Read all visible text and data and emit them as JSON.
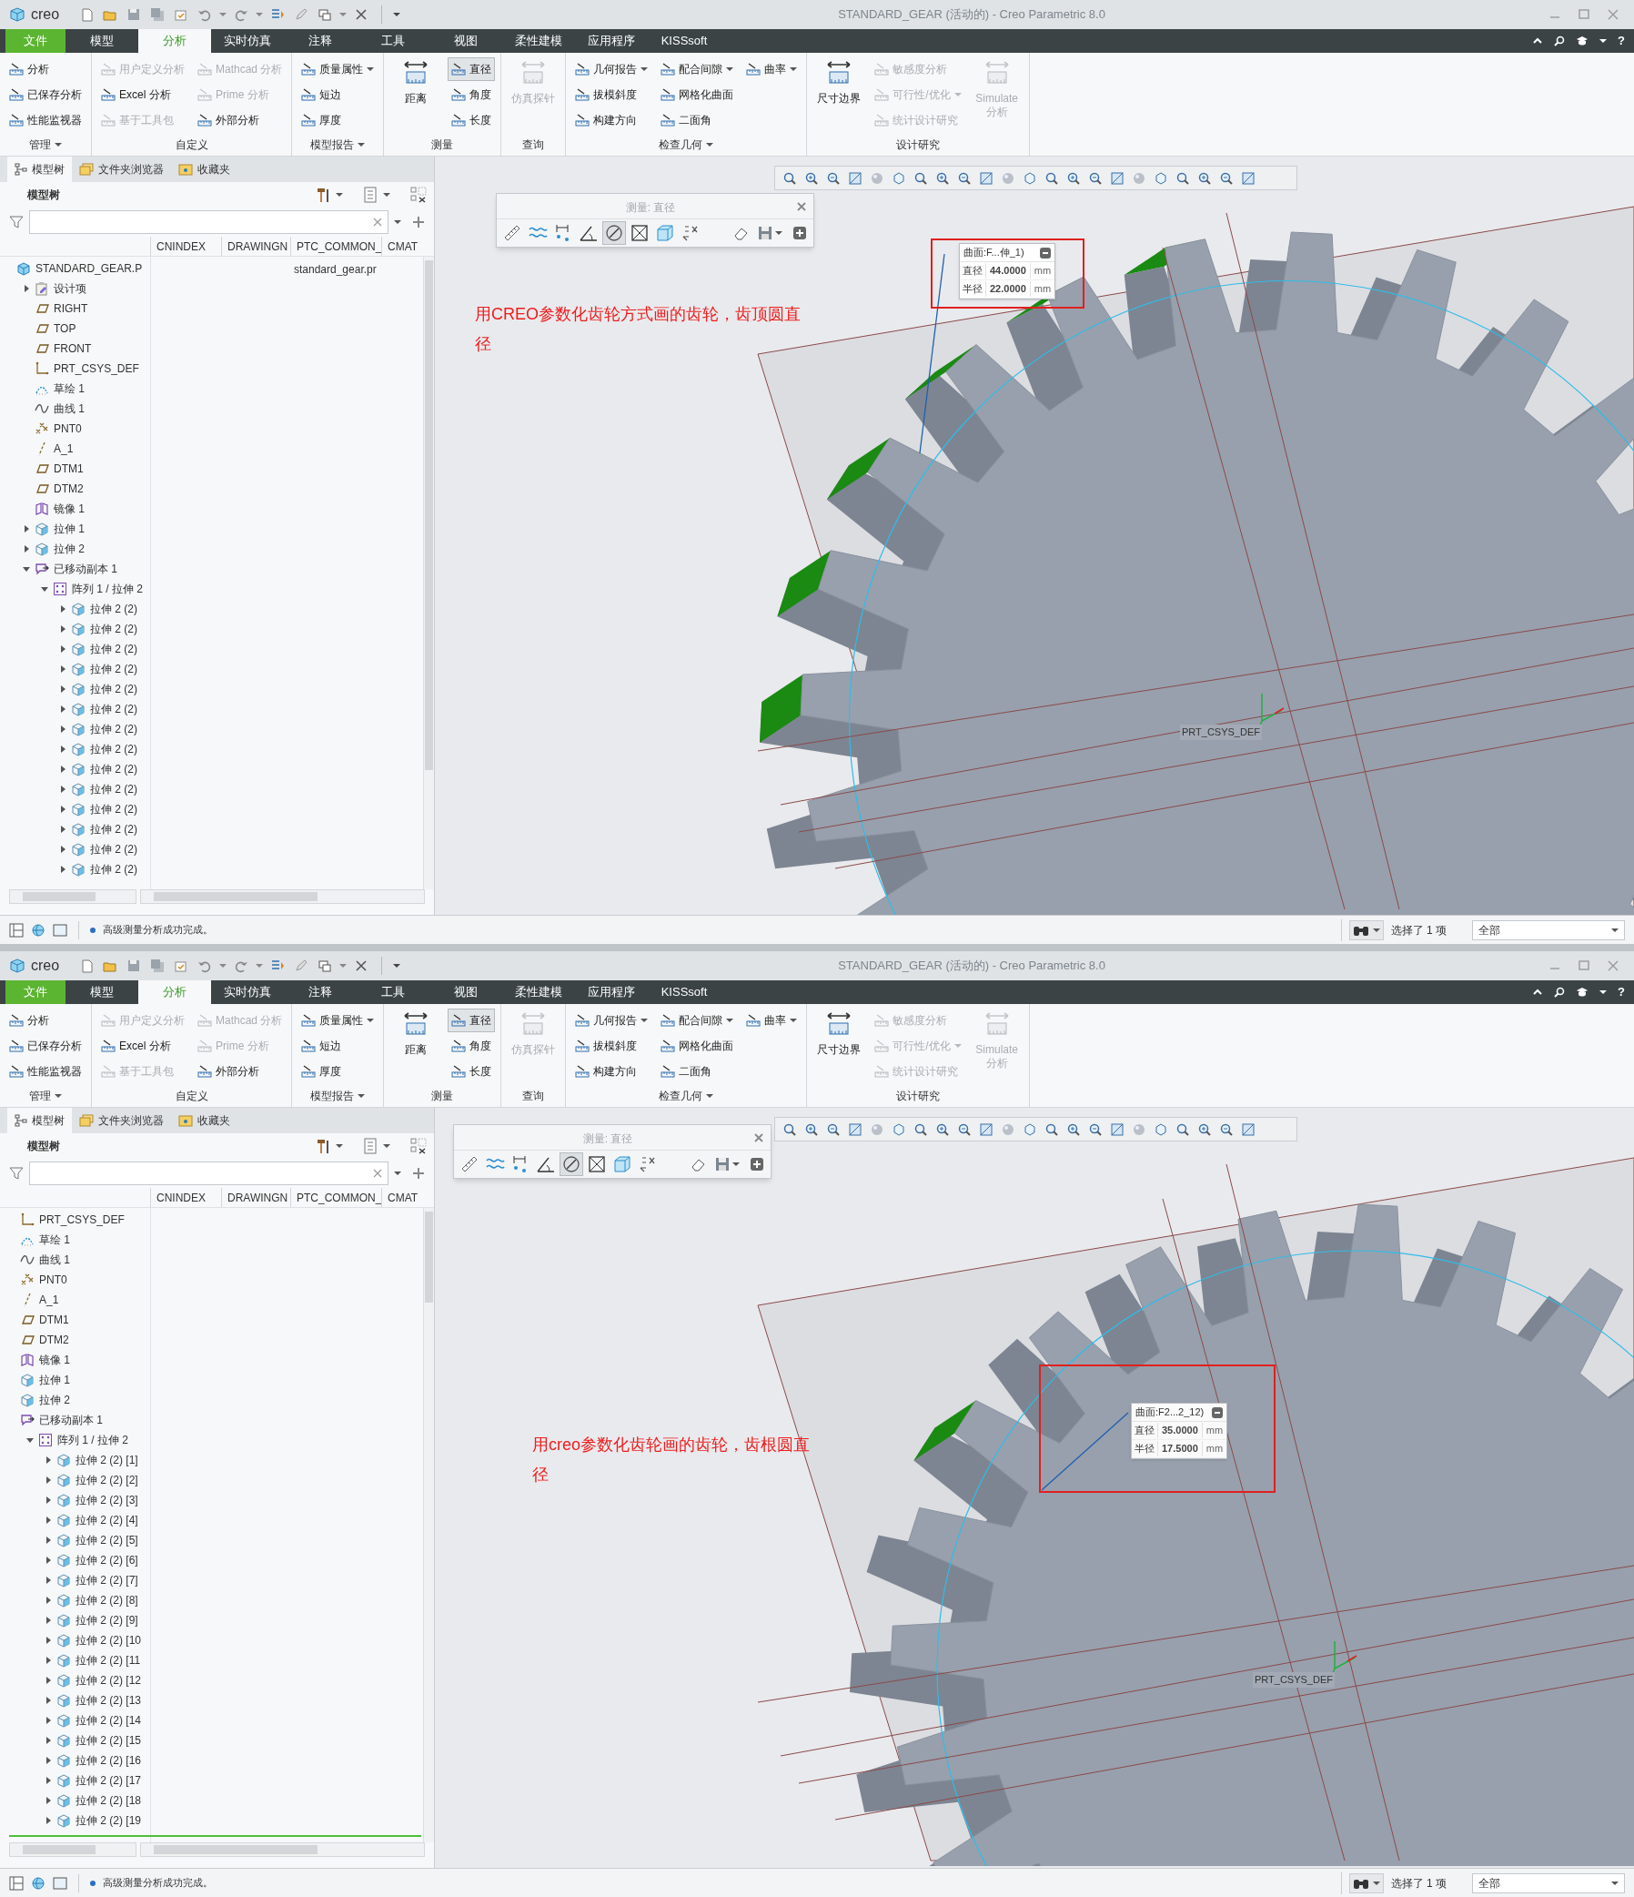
{
  "windows": [
    {
      "title_bar": {
        "logo": "creo",
        "title": "STANDARD_GEAR (活动的) - Creo Parametric 8.0"
      },
      "menu_tabs": [
        {
          "label": "文件",
          "kind": "file",
          "selected": false
        },
        {
          "label": "模型",
          "kind": "tab",
          "selected": false
        },
        {
          "label": "分析",
          "kind": "tab",
          "selected": true
        },
        {
          "label": "实时仿真",
          "kind": "tab",
          "selected": false
        },
        {
          "label": "注释",
          "kind": "tab",
          "selected": false
        },
        {
          "label": "工具",
          "kind": "tab",
          "selected": false
        },
        {
          "label": "视图",
          "kind": "tab",
          "selected": false
        },
        {
          "label": "柔性建模",
          "kind": "tab",
          "selected": false
        },
        {
          "label": "应用程序",
          "kind": "tab",
          "selected": false
        },
        {
          "label": "KISSsoft",
          "kind": "tab",
          "selected": false
        }
      ],
      "help": "?",
      "ribbon": [
        {
          "label": "管理",
          "dropdown": true,
          "columns": [
            [
              {
                "label": "分析",
                "kind": "small",
                "disabled": false
              },
              {
                "label": "已保存分析",
                "kind": "small",
                "disabled": false
              },
              {
                "label": "性能监视器",
                "kind": "small",
                "disabled": false
              }
            ]
          ]
        },
        {
          "label": "自定义",
          "dropdown": false,
          "columns": [
            [
              {
                "label": "用户定义分析",
                "kind": "small",
                "disabled": true
              },
              {
                "label": "Excel 分析",
                "kind": "small",
                "disabled": false
              },
              {
                "label": "基于工具包",
                "kind": "small",
                "disabled": true
              }
            ],
            [
              {
                "label": "Mathcad 分析",
                "kind": "small",
                "disabled": true
              },
              {
                "label": "Prime 分析",
                "kind": "small",
                "disabled": true
              },
              {
                "label": "外部分析",
                "kind": "small",
                "disabled": false
              }
            ]
          ]
        },
        {
          "label": "模型报告",
          "dropdown": true,
          "columns": [
            [
              {
                "label": "质量属性",
                "kind": "small",
                "disabled": false,
                "dropdown": true
              },
              {
                "label": "短边",
                "kind": "small",
                "disabled": false
              },
              {
                "label": "厚度",
                "kind": "small",
                "disabled": false
              }
            ]
          ]
        },
        {
          "label": "测量",
          "dropdown": false,
          "columns": [
            [
              {
                "label": "距离",
                "kind": "large",
                "disabled": false,
                "selected": false
              }
            ],
            [
              {
                "label": "直径",
                "kind": "small",
                "disabled": false,
                "selected": true
              },
              {
                "label": "角度",
                "kind": "small",
                "disabled": false,
                "selected": false
              },
              {
                "label": "长度",
                "kind": "small",
                "disabled": false,
                "selected": false
              }
            ]
          ]
        },
        {
          "label": "查询",
          "dropdown": false,
          "columns": [
            [
              {
                "label": "仿真探针",
                "kind": "large",
                "disabled": true
              }
            ]
          ]
        },
        {
          "label": "检查几何",
          "dropdown": true,
          "columns": [
            [
              {
                "label": "几何报告",
                "kind": "small",
                "disabled": false,
                "dropdown": true
              },
              {
                "label": "拔模斜度",
                "kind": "small",
                "disabled": false
              },
              {
                "label": "构建方向",
                "kind": "small",
                "disabled": false
              }
            ],
            [
              {
                "label": "配合间隙",
                "kind": "small",
                "disabled": false,
                "dropdown": true
              },
              {
                "label": "网格化曲面",
                "kind": "small",
                "disabled": false
              },
              {
                "label": "二面角",
                "kind": "small",
                "disabled": false
              }
            ],
            [
              {
                "label": "曲率",
                "kind": "small",
                "disabled": false,
                "dropdown": true
              }
            ]
          ]
        },
        {
          "label": "设计研究",
          "dropdown": false,
          "columns": [
            [
              {
                "label": "尺寸边界",
                "kind": "large",
                "disabled": false
              }
            ],
            [
              {
                "label": "敏感度分析",
                "kind": "small",
                "disabled": true
              },
              {
                "label": "可行性/优化",
                "kind": "small",
                "disabled": true,
                "dropdown": true
              },
              {
                "label": "统计设计研究",
                "kind": "small",
                "disabled": true
              }
            ],
            [
              {
                "label": "Simulate 分析",
                "kind": "large",
                "disabled": true
              }
            ]
          ]
        }
      ],
      "panel_tabs": [
        {
          "label": "模型树",
          "selected": true
        },
        {
          "label": "文件夹浏览器",
          "selected": false
        },
        {
          "label": "收藏夹",
          "selected": false
        }
      ],
      "tree_title": "模型树",
      "tree_columns": [
        "CNINDEX",
        "DRAWINGN",
        "PTC_COMMON_",
        "CMAT"
      ],
      "tree": [
        {
          "label": "STANDARD_GEAR.P",
          "kind": "part",
          "ptc_common": "standard_gear.pr",
          "children": [
            {
              "label": "设计项",
              "kind": "design_items",
              "expanded": false
            },
            {
              "label": "RIGHT",
              "kind": "plane"
            },
            {
              "label": "TOP",
              "kind": "plane"
            },
            {
              "label": "FRONT",
              "kind": "plane"
            },
            {
              "label": "PRT_CSYS_DEF",
              "kind": "csys"
            },
            {
              "label": "草绘 1",
              "kind": "sketch"
            },
            {
              "label": "曲线 1",
              "kind": "curve"
            },
            {
              "label": "PNT0",
              "kind": "point"
            },
            {
              "label": "A_1",
              "kind": "axis"
            },
            {
              "label": "DTM1",
              "kind": "plane"
            },
            {
              "label": "DTM2",
              "kind": "plane"
            },
            {
              "label": "镜像 1",
              "kind": "mirror"
            },
            {
              "label": "拉伸 1",
              "kind": "extrude",
              "expanded": false
            },
            {
              "label": "拉伸 2",
              "kind": "extrude",
              "expanded": false
            },
            {
              "label": "已移动副本 1",
              "kind": "copy",
              "expanded": true,
              "children": [
                {
                  "label": "阵列 1 / 拉伸 2",
                  "kind": "pattern",
                  "expanded": true,
                  "children": [
                    {
                      "label": "拉伸 2 (2)",
                      "kind": "extrude",
                      "expanded": false
                    },
                    {
                      "label": "拉伸 2 (2)",
                      "kind": "extrude",
                      "expanded": false
                    },
                    {
                      "label": "拉伸 2 (2)",
                      "kind": "extrude",
                      "expanded": false
                    },
                    {
                      "label": "拉伸 2 (2)",
                      "kind": "extrude",
                      "expanded": false
                    },
                    {
                      "label": "拉伸 2 (2)",
                      "kind": "extrude",
                      "expanded": false
                    },
                    {
                      "label": "拉伸 2 (2)",
                      "kind": "extrude",
                      "expanded": false
                    },
                    {
                      "label": "拉伸 2 (2)",
                      "kind": "extrude",
                      "expanded": false
                    },
                    {
                      "label": "拉伸 2 (2)",
                      "kind": "extrude",
                      "expanded": false
                    },
                    {
                      "label": "拉伸 2 (2)",
                      "kind": "extrude",
                      "expanded": false
                    },
                    {
                      "label": "拉伸 2 (2)",
                      "kind": "extrude",
                      "expanded": false
                    },
                    {
                      "label": "拉伸 2 (2)",
                      "kind": "extrude",
                      "expanded": false
                    },
                    {
                      "label": "拉伸 2 (2)",
                      "kind": "extrude",
                      "expanded": false
                    },
                    {
                      "label": "拉伸 2 (2)",
                      "kind": "extrude",
                      "expanded": false
                    },
                    {
                      "label": "拉伸 2 (2)",
                      "kind": "extrude",
                      "expanded": false
                    }
                  ]
                }
              ]
            }
          ]
        }
      ],
      "measure_popup": {
        "title": "测量: 直径",
        "tools": [
          {
            "selected": false
          },
          {
            "selected": false
          },
          {
            "selected": false
          },
          {
            "selected": false
          },
          {
            "selected": true
          },
          {
            "selected": false
          },
          {
            "selected": false
          },
          {
            "selected": false
          }
        ]
      },
      "measure_result": {
        "title": "曲面:F...伸_1)",
        "rows": [
          {
            "label": "直径",
            "value": "44.0000",
            "unit": "mm"
          },
          {
            "label": "半径",
            "value": "22.0000",
            "unit": "mm"
          }
        ]
      },
      "annotation": "用CREO参数化齿轮方式画的齿轮，齿顶圆直径",
      "csys_label": "PRT_CSYS_DEF",
      "status_bar": {
        "message": "高级测量分析成功完成。",
        "selection": "选择了 1 项",
        "filter": "全部"
      }
    },
    {
      "title_bar": {
        "logo": "creo",
        "title": "STANDARD_GEAR (活动的) - Creo Parametric 8.0"
      },
      "menu_tabs": [
        {
          "label": "文件",
          "kind": "file",
          "selected": false
        },
        {
          "label": "模型",
          "kind": "tab",
          "selected": false
        },
        {
          "label": "分析",
          "kind": "tab",
          "selected": true
        },
        {
          "label": "实时仿真",
          "kind": "tab",
          "selected": false
        },
        {
          "label": "注释",
          "kind": "tab",
          "selected": false
        },
        {
          "label": "工具",
          "kind": "tab",
          "selected": false
        },
        {
          "label": "视图",
          "kind": "tab",
          "selected": false
        },
        {
          "label": "柔性建模",
          "kind": "tab",
          "selected": false
        },
        {
          "label": "应用程序",
          "kind": "tab",
          "selected": false
        },
        {
          "label": "KISSsoft",
          "kind": "tab",
          "selected": false
        }
      ],
      "help": "?",
      "ribbon": [
        {
          "label": "管理",
          "dropdown": true,
          "columns": [
            [
              {
                "label": "分析",
                "kind": "small",
                "disabled": false
              },
              {
                "label": "已保存分析",
                "kind": "small",
                "disabled": false
              },
              {
                "label": "性能监视器",
                "kind": "small",
                "disabled": false
              }
            ]
          ]
        },
        {
          "label": "自定义",
          "dropdown": false,
          "columns": [
            [
              {
                "label": "用户定义分析",
                "kind": "small",
                "disabled": true
              },
              {
                "label": "Excel 分析",
                "kind": "small",
                "disabled": false
              },
              {
                "label": "基于工具包",
                "kind": "small",
                "disabled": true
              }
            ],
            [
              {
                "label": "Mathcad 分析",
                "kind": "small",
                "disabled": true
              },
              {
                "label": "Prime 分析",
                "kind": "small",
                "disabled": true
              },
              {
                "label": "外部分析",
                "kind": "small",
                "disabled": false
              }
            ]
          ]
        },
        {
          "label": "模型报告",
          "dropdown": true,
          "columns": [
            [
              {
                "label": "质量属性",
                "kind": "small",
                "disabled": false,
                "dropdown": true
              },
              {
                "label": "短边",
                "kind": "small",
                "disabled": false
              },
              {
                "label": "厚度",
                "kind": "small",
                "disabled": false
              }
            ]
          ]
        },
        {
          "label": "测量",
          "dropdown": false,
          "columns": [
            [
              {
                "label": "距离",
                "kind": "large",
                "disabled": false,
                "selected": false
              }
            ],
            [
              {
                "label": "直径",
                "kind": "small",
                "disabled": false,
                "selected": true
              },
              {
                "label": "角度",
                "kind": "small",
                "disabled": false,
                "selected": false
              },
              {
                "label": "长度",
                "kind": "small",
                "disabled": false,
                "selected": false
              }
            ]
          ]
        },
        {
          "label": "查询",
          "dropdown": false,
          "columns": [
            [
              {
                "label": "仿真探针",
                "kind": "large",
                "disabled": true
              }
            ]
          ]
        },
        {
          "label": "检查几何",
          "dropdown": true,
          "columns": [
            [
              {
                "label": "几何报告",
                "kind": "small",
                "disabled": false,
                "dropdown": true
              },
              {
                "label": "拔模斜度",
                "kind": "small",
                "disabled": false
              },
              {
                "label": "构建方向",
                "kind": "small",
                "disabled": false
              }
            ],
            [
              {
                "label": "配合间隙",
                "kind": "small",
                "disabled": false,
                "dropdown": true
              },
              {
                "label": "网格化曲面",
                "kind": "small",
                "disabled": false
              },
              {
                "label": "二面角",
                "kind": "small",
                "disabled": false
              }
            ],
            [
              {
                "label": "曲率",
                "kind": "small",
                "disabled": false,
                "dropdown": true
              }
            ]
          ]
        },
        {
          "label": "设计研究",
          "dropdown": false,
          "columns": [
            [
              {
                "label": "尺寸边界",
                "kind": "large",
                "disabled": false
              }
            ],
            [
              {
                "label": "敏感度分析",
                "kind": "small",
                "disabled": true
              },
              {
                "label": "可行性/优化",
                "kind": "small",
                "disabled": true,
                "dropdown": true
              },
              {
                "label": "统计设计研究",
                "kind": "small",
                "disabled": true
              }
            ],
            [
              {
                "label": "Simulate 分析",
                "kind": "large",
                "disabled": true
              }
            ]
          ]
        }
      ],
      "panel_tabs": [
        {
          "label": "模型树",
          "selected": true
        },
        {
          "label": "文件夹浏览器",
          "selected": false
        },
        {
          "label": "收藏夹",
          "selected": false
        }
      ],
      "tree_title": "模型树",
      "tree_columns": [
        "CNINDEX",
        "DRAWINGN",
        "PTC_COMMON_",
        "CMAT"
      ],
      "tree": [
        {
          "label": "PRT_CSYS_DEF",
          "kind": "csys"
        },
        {
          "label": "草绘 1",
          "kind": "sketch"
        },
        {
          "label": "曲线 1",
          "kind": "curve"
        },
        {
          "label": "PNT0",
          "kind": "point"
        },
        {
          "label": "A_1",
          "kind": "axis"
        },
        {
          "label": "DTM1",
          "kind": "plane"
        },
        {
          "label": "DTM2",
          "kind": "plane"
        },
        {
          "label": "镜像 1",
          "kind": "mirror"
        },
        {
          "label": "拉伸 1",
          "kind": "extrude"
        },
        {
          "label": "拉伸 2",
          "kind": "extrude"
        },
        {
          "label": "已移动副本 1",
          "kind": "copy",
          "children": [
            {
              "label": "阵列 1 / 拉伸 2",
              "kind": "pattern",
              "expanded": true,
              "children": [
                {
                  "label": "拉伸 2 (2) [1]",
                  "kind": "extrude",
                  "expanded": false
                },
                {
                  "label": "拉伸 2 (2) [2]",
                  "kind": "extrude",
                  "expanded": false
                },
                {
                  "label": "拉伸 2 (2) [3]",
                  "kind": "extrude",
                  "expanded": false
                },
                {
                  "label": "拉伸 2 (2) [4]",
                  "kind": "extrude",
                  "expanded": false
                },
                {
                  "label": "拉伸 2 (2) [5]",
                  "kind": "extrude",
                  "expanded": false
                },
                {
                  "label": "拉伸 2 (2) [6]",
                  "kind": "extrude",
                  "expanded": false
                },
                {
                  "label": "拉伸 2 (2) [7]",
                  "kind": "extrude",
                  "expanded": false
                },
                {
                  "label": "拉伸 2 (2) [8]",
                  "kind": "extrude",
                  "expanded": false
                },
                {
                  "label": "拉伸 2 (2) [9]",
                  "kind": "extrude",
                  "expanded": false
                },
                {
                  "label": "拉伸 2 (2) [10",
                  "kind": "extrude",
                  "expanded": false
                },
                {
                  "label": "拉伸 2 (2) [11",
                  "kind": "extrude",
                  "expanded": false
                },
                {
                  "label": "拉伸 2 (2) [12",
                  "kind": "extrude",
                  "expanded": false
                },
                {
                  "label": "拉伸 2 (2) [13",
                  "kind": "extrude",
                  "expanded": false
                },
                {
                  "label": "拉伸 2 (2) [14",
                  "kind": "extrude",
                  "expanded": false
                },
                {
                  "label": "拉伸 2 (2) [15",
                  "kind": "extrude",
                  "expanded": false
                },
                {
                  "label": "拉伸 2 (2) [16",
                  "kind": "extrude",
                  "expanded": false
                },
                {
                  "label": "拉伸 2 (2) [17",
                  "kind": "extrude",
                  "expanded": false
                },
                {
                  "label": "拉伸 2 (2) [18",
                  "kind": "extrude",
                  "expanded": false
                },
                {
                  "label": "拉伸 2 (2) [19",
                  "kind": "extrude",
                  "expanded": false
                }
              ]
            }
          ]
        }
      ],
      "measure_popup": {
        "title": "测量: 直径",
        "tools": [
          {
            "selected": false
          },
          {
            "selected": false
          },
          {
            "selected": false
          },
          {
            "selected": false
          },
          {
            "selected": true
          },
          {
            "selected": false
          },
          {
            "selected": false
          },
          {
            "selected": false
          }
        ]
      },
      "measure_result": {
        "title": "曲面:F2...2_12)",
        "rows": [
          {
            "label": "直径",
            "value": "35.0000",
            "unit": "mm"
          },
          {
            "label": "半径",
            "value": "17.5000",
            "unit": "mm"
          }
        ]
      },
      "annotation": "用creo参数化齿轮画的齿轮，齿根圆直径",
      "csys_label": "PRT_CSYS_DEF",
      "status_bar": {
        "message": "高级测量分析成功完成。",
        "selection": "选择了 1 项",
        "filter": "全部"
      }
    }
  ]
}
